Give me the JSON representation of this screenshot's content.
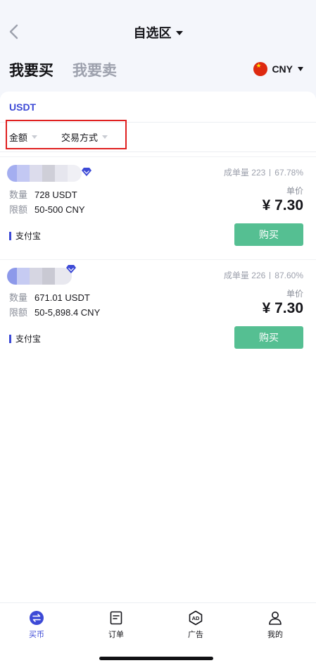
{
  "header": {
    "title": "自选区"
  },
  "mode_tabs": {
    "buy": "我要买",
    "sell": "我要卖"
  },
  "currency": {
    "code": "CNY",
    "flag_icon": "china-flag-icon"
  },
  "asset_tab": {
    "label": "USDT"
  },
  "filters": {
    "amount": "金额",
    "payment_method": "交易方式"
  },
  "offers": [
    {
      "trades_label": "成单量",
      "trades": "223",
      "completion": "67.78%",
      "qty_label": "数量",
      "qty": "728 USDT",
      "limit_label": "限额",
      "limit": "50-500 CNY",
      "price_label": "单价",
      "price": "¥ 7.30",
      "payment": "支付宝",
      "buy_label": "购买"
    },
    {
      "trades_label": "成单量",
      "trades": "226",
      "completion": "87.60%",
      "qty_label": "数量",
      "qty": "671.01 USDT",
      "limit_label": "限额",
      "limit": "50-5,898.4 CNY",
      "price_label": "单价",
      "price": "¥ 7.30",
      "payment": "支付宝",
      "buy_label": "购买"
    }
  ],
  "bottom_nav": [
    {
      "label": "买币",
      "icon": "exchange-icon",
      "active": true
    },
    {
      "label": "订单",
      "icon": "order-icon",
      "active": false
    },
    {
      "label": "广告",
      "icon": "ad-icon",
      "active": false
    },
    {
      "label": "我的",
      "icon": "profile-icon",
      "active": false
    }
  ],
  "colors": {
    "accent": "#3d4ad6",
    "buy_button": "#55bf92",
    "highlight_box": "#e02020",
    "muted_text": "#9da1ad"
  }
}
